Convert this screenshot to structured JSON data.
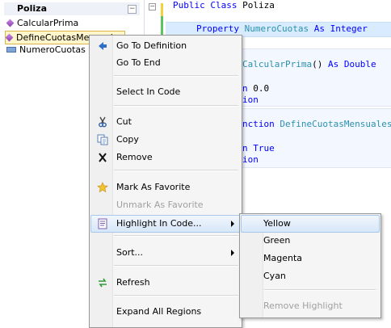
{
  "outline": {
    "class_name": "Poliza",
    "collapse_symbol": "−",
    "items": [
      {
        "label": "CalcularPrima",
        "kind": "method"
      },
      {
        "label": "DefineCuotasMensuales",
        "kind": "method"
      },
      {
        "label": "NumeroCuotas",
        "kind": "property"
      }
    ]
  },
  "editor": {
    "collapse_symbol": "−",
    "lines": [
      {
        "kw1": "Public Class",
        "rest": " Poliza"
      },
      {
        "kw1": "Property",
        "id": " NumeroCuotas",
        "kw2": " As Integer"
      },
      {
        "id": "CalcularPrima",
        "tx": "()",
        "kw2": " As Double"
      },
      {
        "kw1": "n",
        "tx": " 0.0"
      },
      {
        "kw1": "ion"
      },
      {
        "kw1": "nction",
        "id": " DefineCuotasMensuales"
      },
      {
        "kw1": "n True"
      },
      {
        "kw1": "ion"
      }
    ]
  },
  "context_menu": {
    "items": [
      {
        "label": "Go To Definition",
        "icon": "go-to-definition-icon"
      },
      {
        "label": "Go To End"
      },
      {
        "label": "Select In Code"
      },
      {
        "label": "Cut",
        "icon": "cut-icon"
      },
      {
        "label": "Copy",
        "icon": "copy-icon"
      },
      {
        "label": "Remove",
        "icon": "remove-icon"
      },
      {
        "label": "Mark As Favorite",
        "icon": "star-icon"
      },
      {
        "label": "Unmark As Favorite",
        "disabled": true
      },
      {
        "label": "Highlight In Code...",
        "icon": "highlight-icon",
        "submenu": true,
        "selected": true
      },
      {
        "label": "Sort...",
        "submenu": true
      },
      {
        "label": "Refresh",
        "icon": "refresh-icon"
      },
      {
        "label": "Expand All Regions"
      }
    ]
  },
  "highlight_submenu": {
    "items": [
      {
        "label": "Yellow",
        "selected": true
      },
      {
        "label": "Green"
      },
      {
        "label": "Magenta"
      },
      {
        "label": "Cyan"
      },
      {
        "label": "Remove Highlight",
        "disabled": true
      }
    ]
  },
  "colors": {
    "accent_selected": "#d6e7f8",
    "keyword": "#0000ff",
    "identifier": "#2b91af",
    "gutter_changed": "#5cc45c",
    "gutter_current": "#f2d23a"
  }
}
